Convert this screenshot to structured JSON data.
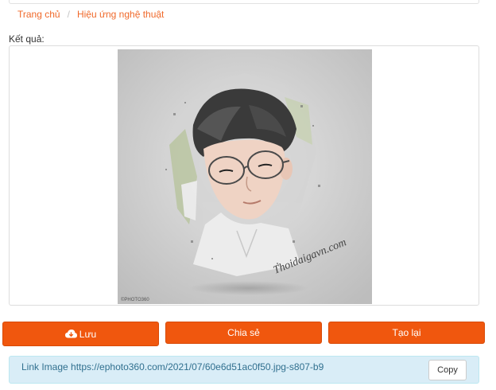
{
  "breadcrumb": {
    "home": "Trang chủ",
    "separator": "/",
    "current": "Hiệu ứng nghệ thuật"
  },
  "result": {
    "label": "Kết quả:",
    "image_watermark": "Thoidaigavn.com",
    "image_credit": "©PHOTO360"
  },
  "actions": {
    "save_label": "Lưu",
    "share_label": "Chia sẻ",
    "recreate_label": "Tạo lại",
    "save_icon": "cloud-download-icon"
  },
  "link": {
    "text": "Link Image https://ephoto360.com/2021/07/60e6d51ac0f50.jpg-s807-b9",
    "copy_label": "Copy"
  },
  "colors": {
    "accent": "#f0570e",
    "link_text": "#f0692a",
    "info_bg": "#d9edf7",
    "info_text": "#31708f"
  }
}
